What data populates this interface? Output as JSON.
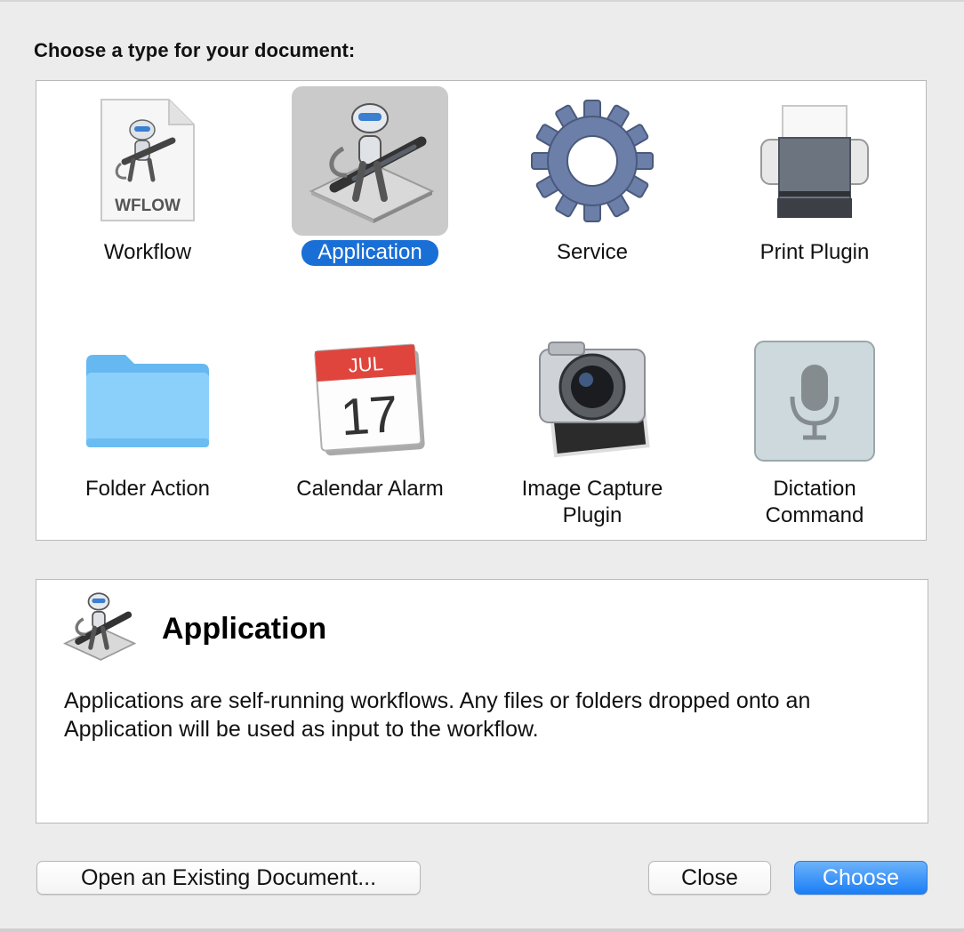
{
  "dialog": {
    "heading": "Choose a type for your document:"
  },
  "types": [
    {
      "label": "Workflow",
      "icon": "workflow-document-icon",
      "badge": "WFLOW"
    },
    {
      "label": "Application",
      "icon": "automator-robot-icon",
      "selected": true
    },
    {
      "label": "Service",
      "icon": "gear-icon"
    },
    {
      "label": "Print Plugin",
      "icon": "printer-icon"
    },
    {
      "label": "Folder Action",
      "icon": "folder-icon"
    },
    {
      "label": "Calendar Alarm",
      "icon": "calendar-icon",
      "month": "JUL",
      "day": "17"
    },
    {
      "label": "Image Capture Plugin",
      "label_line1": "Image Capture",
      "label_line2": "Plugin",
      "icon": "camera-icon"
    },
    {
      "label": "Dictation Command",
      "label_line1": "Dictation",
      "label_line2": "Command",
      "icon": "microphone-icon"
    }
  ],
  "description": {
    "title": "Application",
    "text": "Applications are self-running workflows. Any files or folders dropped onto an Application will be used as input to the workflow."
  },
  "buttons": {
    "open_existing": "Open an Existing Document...",
    "close": "Close",
    "choose": "Choose"
  },
  "colors": {
    "selection": "#1a6fd6",
    "primary_button": "#1b7ef5",
    "background": "#ececec"
  }
}
